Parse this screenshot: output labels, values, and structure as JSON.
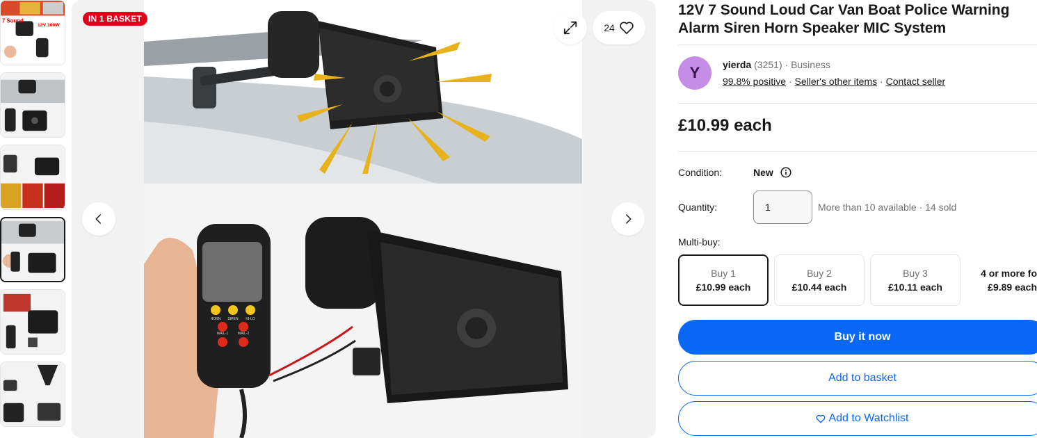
{
  "gallery": {
    "badge": "IN 1 BASKET",
    "watch_count": "24",
    "thumbnail_icons": [
      "siren-kit-thumb",
      "roof-siren-thumb",
      "fire-trucks-thumb",
      "siren-with-mic-thumb",
      "box-contents-thumb",
      "siren-parts-thumb"
    ],
    "thumbnail_text": {
      "sound": "7 Sound",
      "power": "12V 100W"
    },
    "product_panels": {
      "mic_buttons": [
        "HORN",
        "SIREN",
        "HI-LO",
        "WAIL-1",
        "WAIL-2"
      ]
    }
  },
  "listing": {
    "title": "12V 7 Sound Loud Car Van Boat Police Warning Alarm Siren Horn Speaker MIC System"
  },
  "seller": {
    "initial": "Y",
    "name": "yierda",
    "feedback_count": "(3251)",
    "type": "Business",
    "positive": "99.8% positive",
    "other_items": "Seller's other items",
    "contact": "Contact seller",
    "dot": "·"
  },
  "price": "£10.99 each",
  "condition": {
    "label": "Condition:",
    "value": "New"
  },
  "quantity": {
    "label": "Quantity:",
    "value": "1",
    "availability": "More than 10 available",
    "sold": "14 sold"
  },
  "multibuy": {
    "label": "Multi-buy:",
    "options": [
      {
        "qty": "Buy 1",
        "price": "£10.99 each"
      },
      {
        "qty": "Buy 2",
        "price": "£10.44 each"
      },
      {
        "qty": "Buy 3",
        "price": "£10.11 each"
      },
      {
        "qty": "4 or more fo",
        "price": "£9.89 each"
      }
    ]
  },
  "actions": {
    "buy_now": "Buy it now",
    "add_basket": "Add to basket",
    "add_watchlist": "Add to Watchlist"
  },
  "colors": {
    "primary": "#0968f6",
    "badge": "#e0001b",
    "avatar": "#c58de6"
  }
}
